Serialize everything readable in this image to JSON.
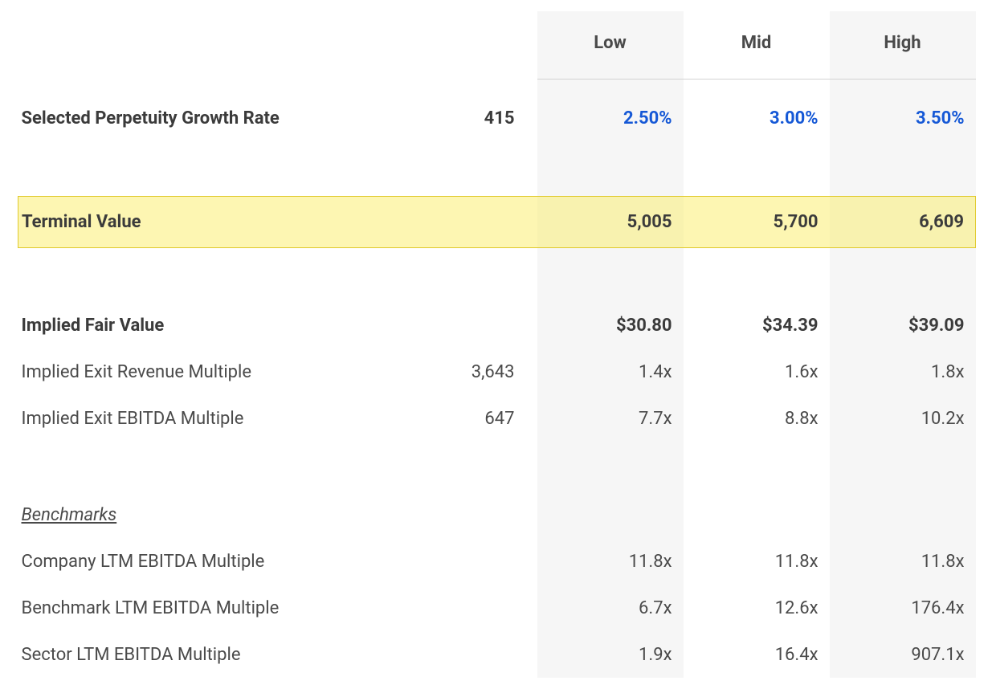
{
  "headers": {
    "low": "Low",
    "mid": "Mid",
    "high": "High"
  },
  "rows": {
    "perpetuity": {
      "label": "Selected Perpetuity Growth Rate",
      "base": "415",
      "low": "2.50%",
      "mid": "3.00%",
      "high": "3.50%"
    },
    "terminal": {
      "label": "Terminal Value",
      "low": "5,005",
      "mid": "5,700",
      "high": "6,609"
    },
    "fairvalue": {
      "label": "Implied Fair Value",
      "low": "$30.80",
      "mid": "$34.39",
      "high": "$39.09"
    },
    "exit_rev": {
      "label": "Implied Exit Revenue Multiple",
      "base": "3,643",
      "low": "1.4x",
      "mid": "1.6x",
      "high": "1.8x"
    },
    "exit_ebitda": {
      "label": "Implied Exit EBITDA Multiple",
      "base": "647",
      "low": "7.7x",
      "mid": "8.8x",
      "high": "10.2x"
    },
    "benchmarks_header": "Benchmarks",
    "company_ltm": {
      "label": "Company LTM EBITDA Multiple",
      "low": "11.8x",
      "mid": "11.8x",
      "high": "11.8x"
    },
    "benchmark_ltm": {
      "label": "Benchmark LTM EBITDA Multiple",
      "low": "6.7x",
      "mid": "12.6x",
      "high": "176.4x"
    },
    "sector_ltm": {
      "label": "Sector LTM EBITDA Multiple",
      "low": "1.9x",
      "mid": "16.4x",
      "high": "907.1x"
    }
  }
}
